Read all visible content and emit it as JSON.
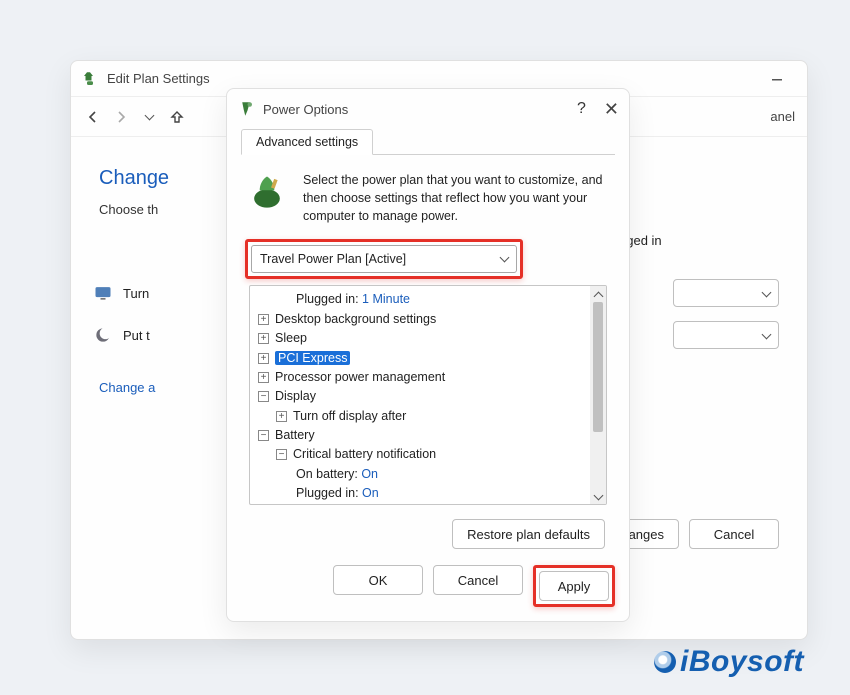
{
  "parent": {
    "title": "Edit Plan Settings",
    "breadcrumb_tail": "anel",
    "heading_cut": "Change",
    "subheading_cut": "Choose th",
    "row_display": "Turn",
    "row_sleep": "Put t",
    "change_link_cut": "Change a",
    "gged_in": "gged in",
    "save_changes_cut": "e changes",
    "cancel": "Cancel"
  },
  "dialog": {
    "title": "Power Options",
    "tab": "Advanced settings",
    "description": "Select the power plan that you want to customize, and then choose settings that reflect how you want your computer to manage power.",
    "plan_selected": "Travel Power Plan [Active]",
    "restore": "Restore plan defaults",
    "ok": "OK",
    "cancel": "Cancel",
    "apply": "Apply"
  },
  "tree": {
    "plugged_label": "Plugged in:",
    "plugged_val": "1 Minute",
    "desktop_bg": "Desktop background settings",
    "sleep": "Sleep",
    "pci": "PCI Express",
    "proc": "Processor power management",
    "display": "Display",
    "turn_off_display": "Turn off display after",
    "battery": "Battery",
    "crit_notif": "Critical battery notification",
    "on_batt_label": "On battery:",
    "on_batt_val": "On",
    "plugged2_label": "Plugged in:",
    "plugged2_val": "On"
  },
  "watermark": "iBoysoft"
}
